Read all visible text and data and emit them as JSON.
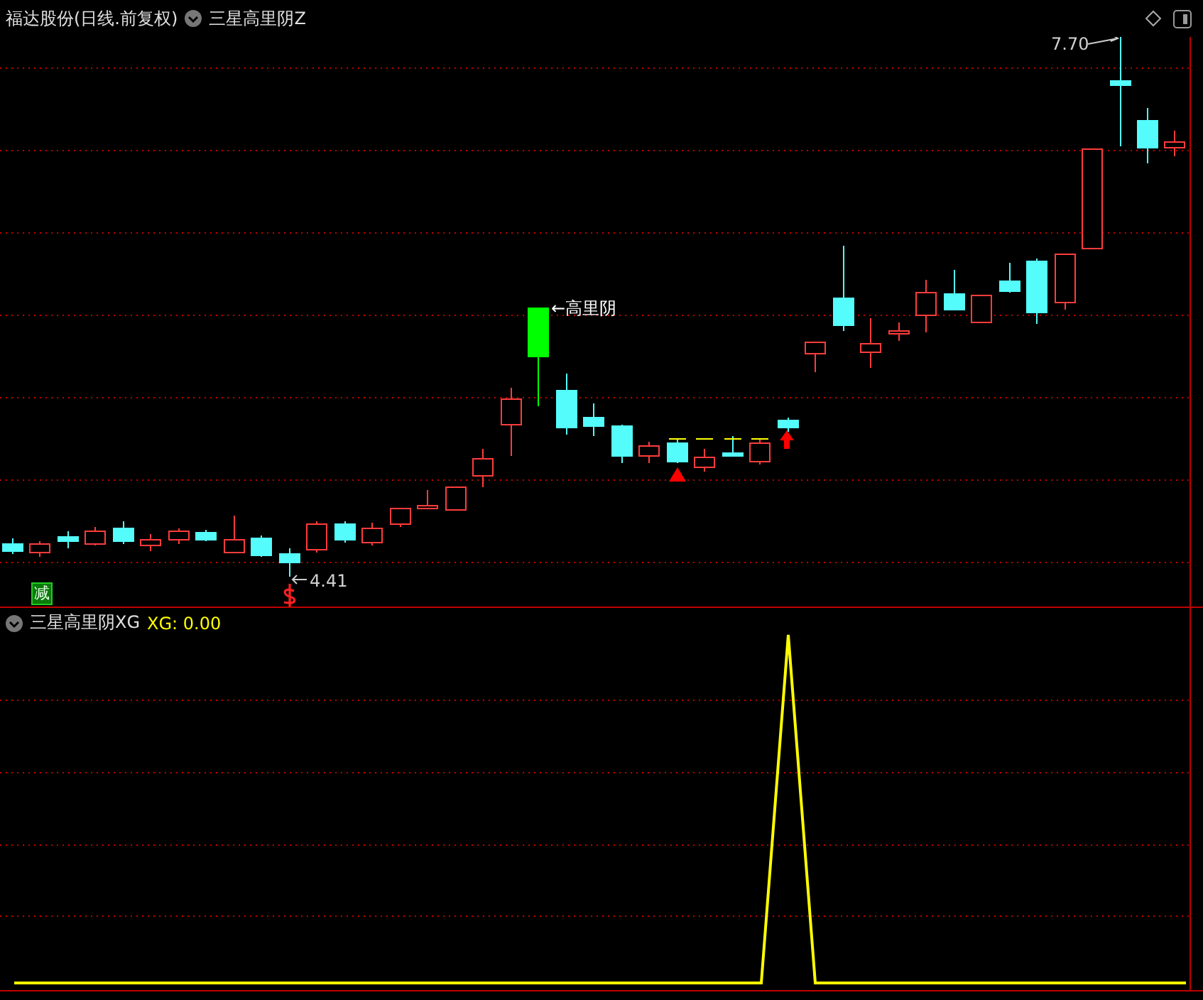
{
  "header": {
    "stock_title": "福达股份(日线.前复权)",
    "indicator": "三星高里阴Z"
  },
  "main_chart": {
    "high_label": "7.70",
    "low_label": "4.41",
    "annotation": "←高里阴",
    "badge": "减"
  },
  "lower_panel": {
    "indicator": "三星高里阴XG",
    "reading": "XG: 0.00"
  }
}
